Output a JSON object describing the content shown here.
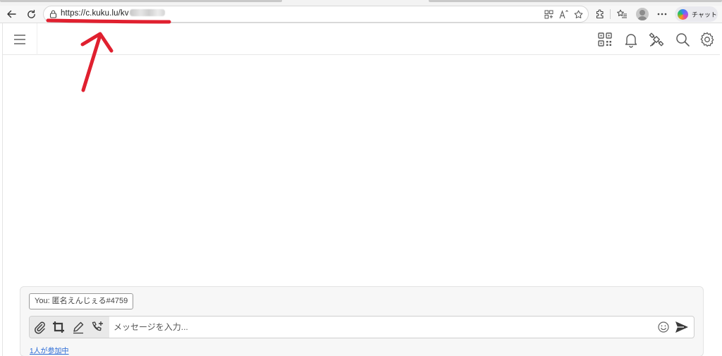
{
  "browser": {
    "url_prefix": "https://c.kuku.lu/",
    "url_visible_suffix": "kv",
    "copilot_label": "チャット"
  },
  "chat": {
    "you_label": "You: 匿名えんじぇる#4759",
    "input_placeholder": "メッセージを入力...",
    "participants_text": "1人が参加中"
  },
  "colors": {
    "annotation": "#e0202f",
    "link": "#2a6bd6"
  },
  "icons": {
    "header": [
      "qr-code-icon",
      "bell-icon",
      "satellite-icon",
      "search-icon",
      "gear-icon"
    ],
    "toolbar": [
      "paperclip-icon",
      "crop-icon",
      "pen-icon",
      "phone-add-icon"
    ]
  }
}
